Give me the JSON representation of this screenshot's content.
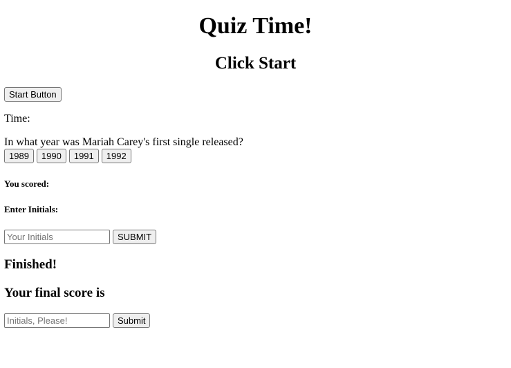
{
  "header": {
    "title": "Quiz Time!",
    "subtitle": "Click Start"
  },
  "start": {
    "button_label": "Start Button"
  },
  "timer": {
    "label": "Time:"
  },
  "question": {
    "text": "In what year was Mariah Carey's first single released?",
    "choices": [
      "1989",
      "1990",
      "1991",
      "1992"
    ]
  },
  "score": {
    "label": "You scored:"
  },
  "initials_form": {
    "label": "Enter Initials:",
    "placeholder": "Your Initials",
    "submit_label": "SUBMIT"
  },
  "finished": {
    "heading": "Finished!",
    "final_score_label": "Your final score is",
    "placeholder": "Initials, Please!",
    "submit_label": "Submit"
  }
}
